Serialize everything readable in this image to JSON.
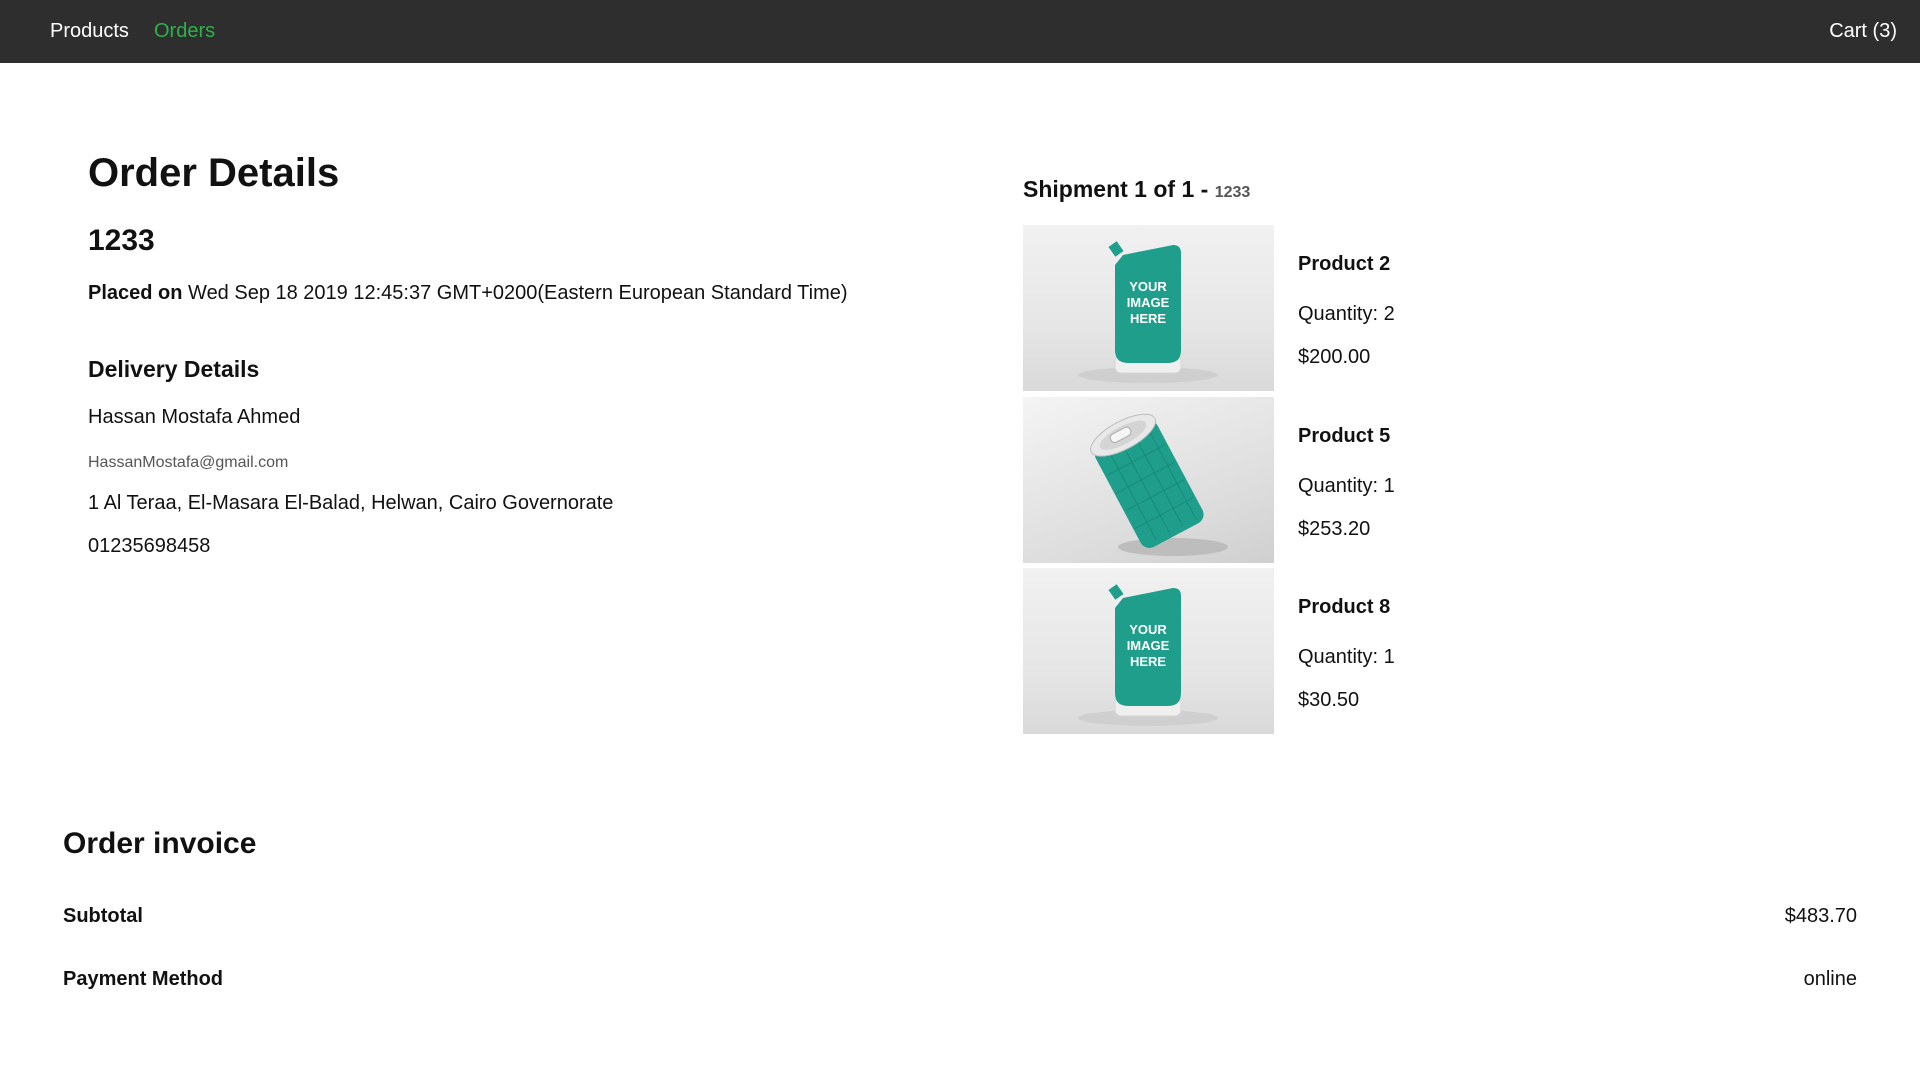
{
  "nav": {
    "products": "Products",
    "orders": "Orders",
    "cart": "Cart (3)",
    "active_color": "#2bb34a",
    "bar_color": "#2e2e2e"
  },
  "order": {
    "title": "Order Details",
    "number": "1233",
    "placed_label": "Placed on",
    "placed_date": "Wed Sep 18 2019 12:45:37 GMT+0200(Eastern European Standard Time)"
  },
  "delivery": {
    "title": "Delivery Details",
    "name": "Hassan Mostafa Ahmed",
    "email": "HassanMostafa@gmail.com",
    "address": "1 Al Teraa, El-Masara El-Balad, Helwan, Cairo Governorate",
    "phone": "01235698458"
  },
  "shipment": {
    "title": "Shipment 1 of 1 - ",
    "id": "1233",
    "products": [
      {
        "name": "Product 2",
        "quantity": "Quantity: 2",
        "price": "$200.00",
        "image": "pouch-mockup",
        "image_text": [
          "YOUR",
          "IMAGE",
          "HERE"
        ]
      },
      {
        "name": "Product 5",
        "quantity": "Quantity: 1",
        "price": "$253.20",
        "image": "can-mockup"
      },
      {
        "name": "Product 8",
        "quantity": "Quantity: 1",
        "price": "$30.50",
        "image": "pouch-mockup",
        "image_text": [
          "YOUR",
          "IMAGE",
          "HERE"
        ]
      }
    ]
  },
  "invoice": {
    "title": "Order invoice",
    "subtotal_label": "Subtotal",
    "subtotal_value": "$483.70",
    "payment_label": "Payment Method",
    "payment_value": "online"
  },
  "colors": {
    "product_teal": "#1f9e8c"
  }
}
